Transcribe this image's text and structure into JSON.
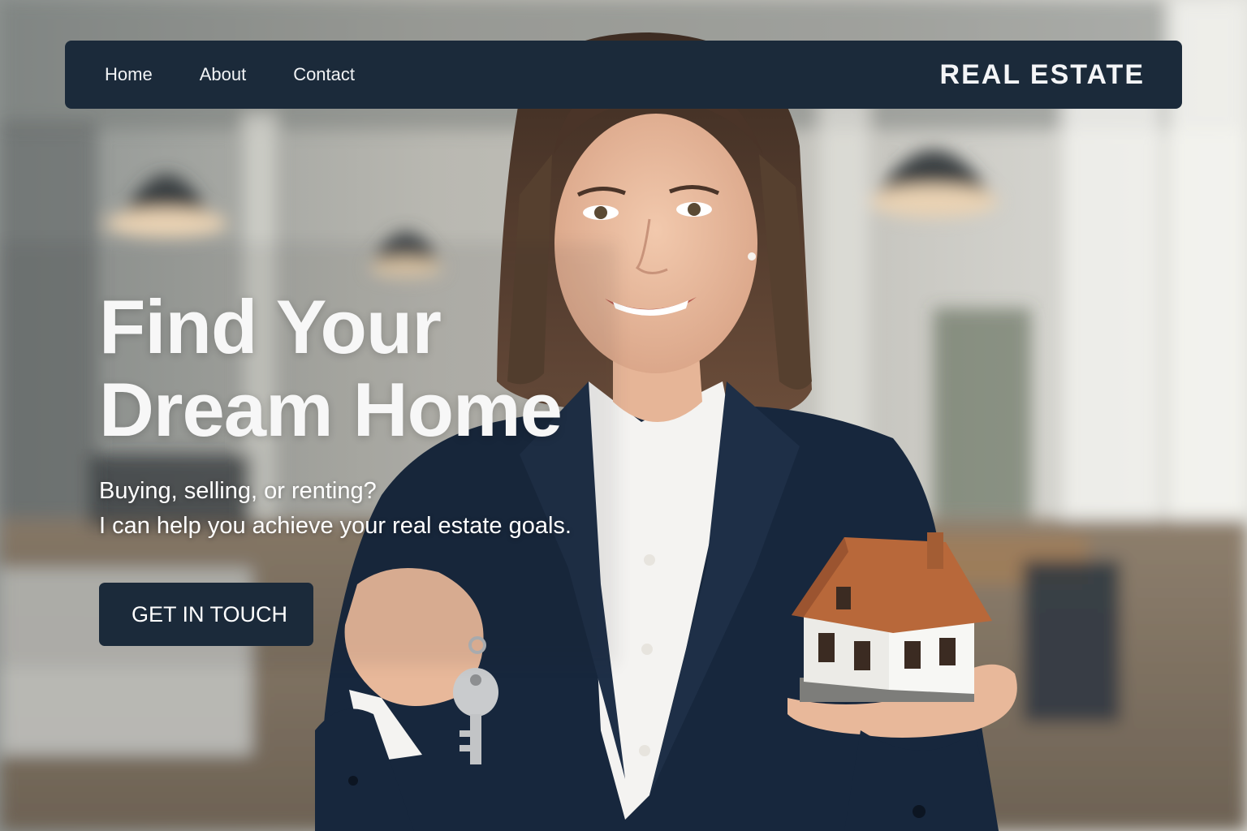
{
  "nav": {
    "links": [
      "Home",
      "About",
      "Contact"
    ],
    "brand": "REAL ESTATE"
  },
  "hero": {
    "title_line1": "Find Your",
    "title_line2": "Dream Home",
    "subtitle_line1": "Buying, selling, or renting?",
    "subtitle_line2": "I can help you achieve your real estate goals.",
    "cta_label": "GET IN TOUCH"
  },
  "colors": {
    "nav_background": "#1b2a3a",
    "button_background": "#1b2a3a",
    "text_light": "#ffffff",
    "jacket_navy": "#17273d",
    "roof_orange": "#b8683a"
  },
  "icons": {
    "key": "key-icon",
    "house_model": "house-model-icon"
  }
}
